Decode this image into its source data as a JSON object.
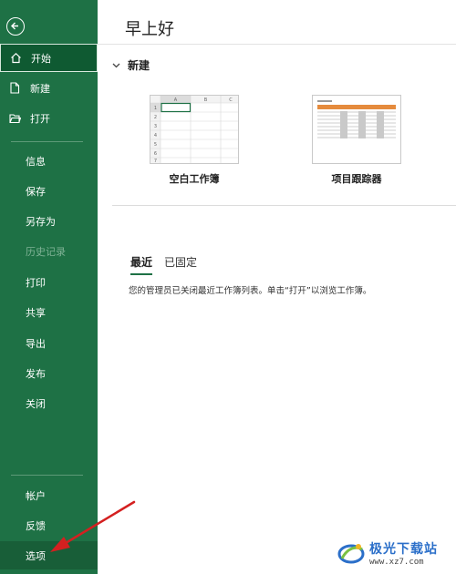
{
  "sidebar": {
    "back_icon": "back-arrow-icon",
    "top_items": [
      {
        "label": "开始",
        "icon": "home-icon"
      },
      {
        "label": "新建",
        "icon": "new-file-icon"
      },
      {
        "label": "打开",
        "icon": "folder-open-icon"
      }
    ],
    "middle_items": [
      {
        "label": "信息"
      },
      {
        "label": "保存"
      },
      {
        "label": "另存为"
      },
      {
        "label": "历史记录",
        "disabled": true
      },
      {
        "label": "打印"
      },
      {
        "label": "共享"
      },
      {
        "label": "导出"
      },
      {
        "label": "发布"
      },
      {
        "label": "关闭"
      }
    ],
    "bottom_items": [
      {
        "label": "帐户"
      },
      {
        "label": "反馈"
      },
      {
        "label": "选项"
      }
    ]
  },
  "main": {
    "greeting": "早上好",
    "new_section": {
      "title": "新建",
      "collapse_icon": "chevron-down-icon"
    },
    "templates": [
      {
        "label": "空白工作簿"
      },
      {
        "label": "项目跟踪器"
      }
    ],
    "blank_sheet": {
      "columns": [
        "A",
        "B",
        "C"
      ],
      "rows": [
        "1",
        "2",
        "3",
        "4",
        "5",
        "6",
        "7"
      ]
    },
    "tabs": [
      {
        "label": "最近",
        "active": true
      },
      {
        "label": "已固定",
        "active": false
      }
    ],
    "notice": "您的管理员已关闭最近工作簿列表。单击“打开”以浏览工作簿。"
  },
  "watermark": {
    "title": "极光下载站",
    "url": "www.xz7.com"
  },
  "colors": {
    "sidebar": "#1e7145",
    "accent": "#1e7145",
    "arrow": "#d42020"
  }
}
